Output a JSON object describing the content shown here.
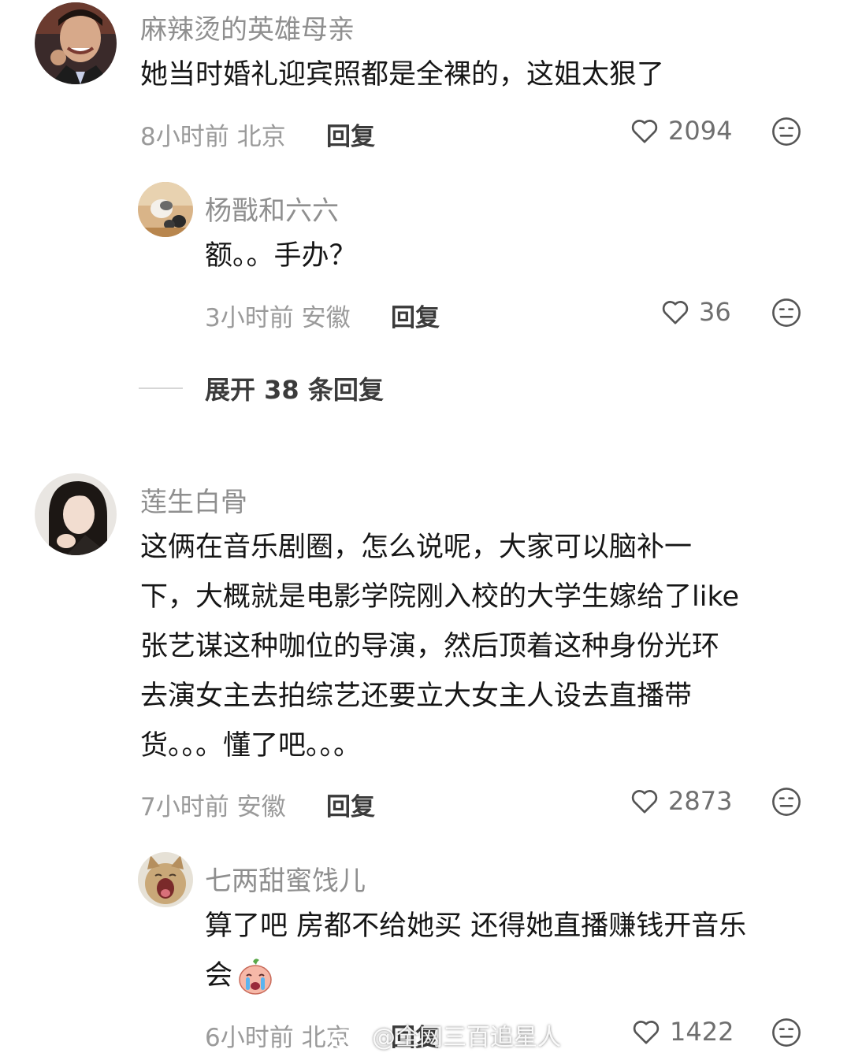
{
  "comments": [
    {
      "user": "麻辣烫的英雄母亲",
      "text": "她当时婚礼迎宾照都是全裸的，这姐太狠了",
      "time_location": "8小时前 北京",
      "reply_label": "回复",
      "likes": "2094",
      "avatar_icon": "avatar-man-smiling",
      "replies": [
        {
          "user": "杨戬和六六",
          "text": "额。。手办？",
          "time_location": "3小时前 安徽",
          "reply_label": "回复",
          "likes": "36",
          "avatar_icon": "avatar-cats"
        }
      ],
      "expand_label": "展开 38 条回复"
    },
    {
      "user": "莲生白骨",
      "text_lines": [
        "这俩在音乐剧圈，怎么说呢，大家可以脑补一",
        "下，大概就是电影学院刚入校的大学生嫁给了like",
        "张艺谋这种咖位的导演，然后顶着这种身份光环",
        "去演女主去拍综艺还要立大女主人设去直播带",
        "货。。。懂了吧。。。"
      ],
      "time_location": "7小时前 安徽",
      "reply_label": "回复",
      "likes": "2873",
      "avatar_icon": "avatar-woman",
      "replies": [
        {
          "user": "七两甜蜜饯儿",
          "text_lines": [
            "算了吧 房都不给她买 还得她直播赚钱开音乐",
            "会"
          ],
          "emoji": "crying-face-emoji",
          "time_location": "6小时前 北京",
          "reply_label": "回复",
          "likes": "1422",
          "avatar_icon": "avatar-cat-yawning"
        }
      ]
    }
  ],
  "watermark": "@全网三百追星人",
  "icons": {
    "like": "heart-outline-icon",
    "dislike": "meh-face-icon",
    "watermark_logo": "weibo-logo-icon"
  }
}
